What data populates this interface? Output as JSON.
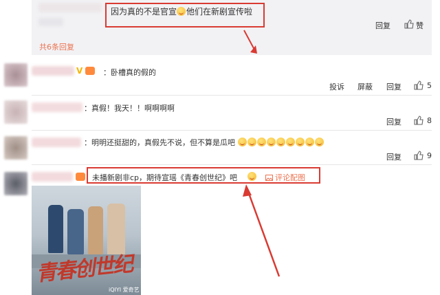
{
  "reply_box": {
    "text": "因为真的不是官宣",
    "text_after_emoji": "他们在新剧宣传啦",
    "reply_label": "回复",
    "like_count": "赞",
    "more_replies": "共6条回复"
  },
  "comments": [
    {
      "text": "卧槽真的假的",
      "actions": {
        "report": "投诉",
        "block": "屏蔽",
        "reply": "回复"
      },
      "like_count": "5"
    },
    {
      "text": "：真假！我天！！啊啊啊啊",
      "actions": {
        "reply": "回复"
      },
      "like_count": "8"
    },
    {
      "text": "：明明还挺甜的，真假先不说，但不算是瓜吧",
      "actions": {
        "reply": "回复"
      },
      "like_count": "9"
    },
    {
      "text": "未播新剧非cp，期待宣瑶《青春创世纪》吧",
      "tag": "评论配图",
      "poster_title": "青春创世纪",
      "poster_sub": "iQIYI 爱奇艺"
    }
  ],
  "colors": {
    "highlight": "#d93a32",
    "link": "#eb7350",
    "reply_bg": "#f2f2f5"
  }
}
